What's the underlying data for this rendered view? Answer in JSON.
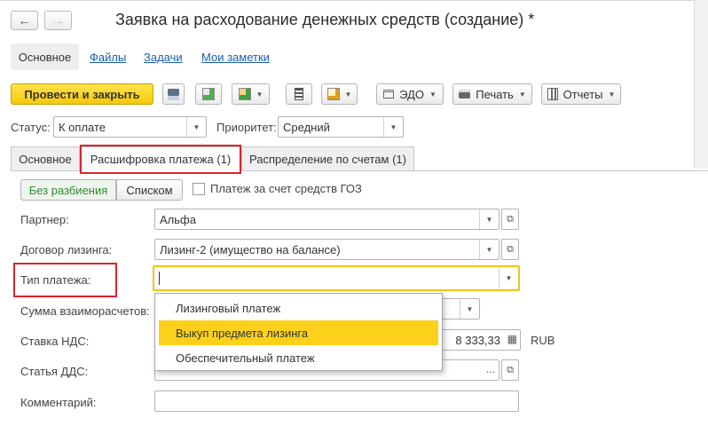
{
  "window": {
    "title": "Заявка на расходование денежных средств (создание) *"
  },
  "nav": {
    "back_icon": "←",
    "forward_icon": "→"
  },
  "sections": [
    {
      "label": "Основное",
      "active": true
    },
    {
      "label": "Файлы"
    },
    {
      "label": "Задачи"
    },
    {
      "label": "Мои заметки"
    }
  ],
  "toolbar": {
    "post_close": "Провести и закрыть",
    "edo": "ЭДО",
    "print": "Печать",
    "reports": "Отчеты"
  },
  "status": {
    "label": "Статус:",
    "value": "К оплате"
  },
  "priority": {
    "label": "Приоритет:",
    "value": "Средний"
  },
  "tabs": [
    {
      "label": "Основное"
    },
    {
      "label": "Расшифровка платежа (1)",
      "active": true
    },
    {
      "label": "Распределение по счетам (1)"
    }
  ],
  "split_mode": {
    "no_split": "Без разбиения",
    "list": "Списком"
  },
  "goz_checkbox": {
    "label": "Платеж за счет средств ГОЗ",
    "checked": false
  },
  "form": {
    "partner": {
      "label": "Партнер:",
      "value": "Альфа"
    },
    "contract": {
      "label": "Договор лизинга:",
      "value": "Лизинг-2 (имущество на балансе)"
    },
    "payment_type": {
      "label": "Тип платежа:",
      "value": ""
    },
    "settlement_amount": {
      "label": "Сумма взаиморасчетов:"
    },
    "vat_rate": {
      "label": "Ставка НДС:",
      "amount": "8 333,33",
      "currency": "RUB"
    },
    "dds_item": {
      "label": "Статья ДДС:"
    },
    "comment": {
      "label": "Комментарий:",
      "value": ""
    }
  },
  "payment_type_options": [
    {
      "label": "Лизинговый платеж"
    },
    {
      "label": "Выкуп предмета лизинга",
      "selected": true
    },
    {
      "label": "Обеспечительный платеж"
    }
  ],
  "colors": {
    "primary_button": "#f6c808",
    "highlight_red": "#d9252b",
    "selected_option": "#fdd11b",
    "link": "#1a5fa8",
    "active_segment_text": "#2d8b2d",
    "focus_border": "#f0c419"
  }
}
